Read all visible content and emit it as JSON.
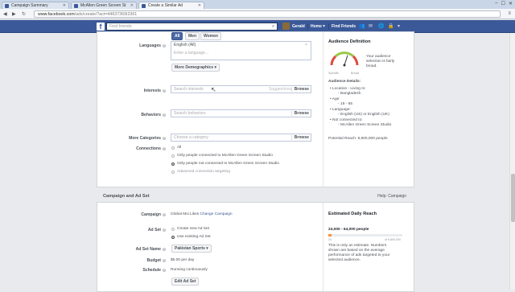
{
  "browser": {
    "tabs": [
      {
        "title": "Campaign Summary"
      },
      {
        "title": "McAllen Green Screen St"
      },
      {
        "title": "Create a Similar Ad"
      }
    ],
    "url_host": "www.facebook.com",
    "url_path": "/ads/create/?act=44637369I2361"
  },
  "fb": {
    "search_placeholder": "Find friends",
    "user_name": "Gerald",
    "home_label": "Home",
    "find_friends_label": "Find Friends"
  },
  "targeting": {
    "gender_options": [
      "All",
      "Men",
      "Women"
    ],
    "languages_label": "Languages",
    "language_selected": "English (All)",
    "language_placeholder": "Enter a language...",
    "more_demographics": "More Demographics",
    "interests_label": "Interests",
    "interests_placeholder": "Search interests",
    "suggestions": "Suggestions",
    "browse": "Browse",
    "behaviors_label": "Behaviors",
    "behaviors_placeholder": "Search behaviors",
    "more_categories_label": "More Categories",
    "category_placeholder": "Choose a category",
    "connections_label": "Connections",
    "connection_options": [
      "All",
      "Only people connected to McAllen Green Screen Studio",
      "Only people not connected to McAllen Green Screen Studio",
      "Advanced connection targeting"
    ]
  },
  "audience": {
    "title": "Audience Definition",
    "gauge_left": "Specific",
    "gauge_right": "Broad",
    "gauge_level": 0.62,
    "description": [
      "Your audience",
      "selection is fairly",
      "broad."
    ],
    "details_title": "Audience Details:",
    "details": [
      "Location - Living In:",
      "Bangladesh",
      "Age:",
      "18 - 65",
      "Language:",
      "English (US) or English (UK)",
      "Not connected to:",
      "McAllen Green Screen Studio"
    ],
    "potential_reach": "Potential Reach: 8,800,000 people"
  },
  "campaign_section": {
    "title": "Campaign and Ad Set",
    "help": "Help: Campaign"
  },
  "campaign": {
    "campaign_label": "Campaign",
    "campaign_value": "Global Mxi Likes",
    "change_campaign": "Change Campaign",
    "adset_label": "Ad Set",
    "adset_options": [
      "Create new Ad Set",
      "Use existing Ad Set"
    ],
    "adset_name_label": "Ad Set Name",
    "adset_name_value": "Pakistan Sports",
    "budget_label": "Budget",
    "budget_value": "$5.00 per day",
    "schedule_label": "Schedule",
    "schedule_value": "Running continuously",
    "edit_button": "Edit Ad Set"
  },
  "reach": {
    "title": "Estimated Daily Reach",
    "range": "24,000 - 64,000 people",
    "scale_left": "24",
    "scale_right": "of 9,800,000",
    "level": 0.04,
    "note": [
      "This is only an estimate. Numbers",
      "shown are based on the average",
      "performance of ads targeted to your",
      "selected audience."
    ]
  },
  "colors": {
    "fb_blue": "#3b5998",
    "reach_orange": "#f7923a"
  }
}
